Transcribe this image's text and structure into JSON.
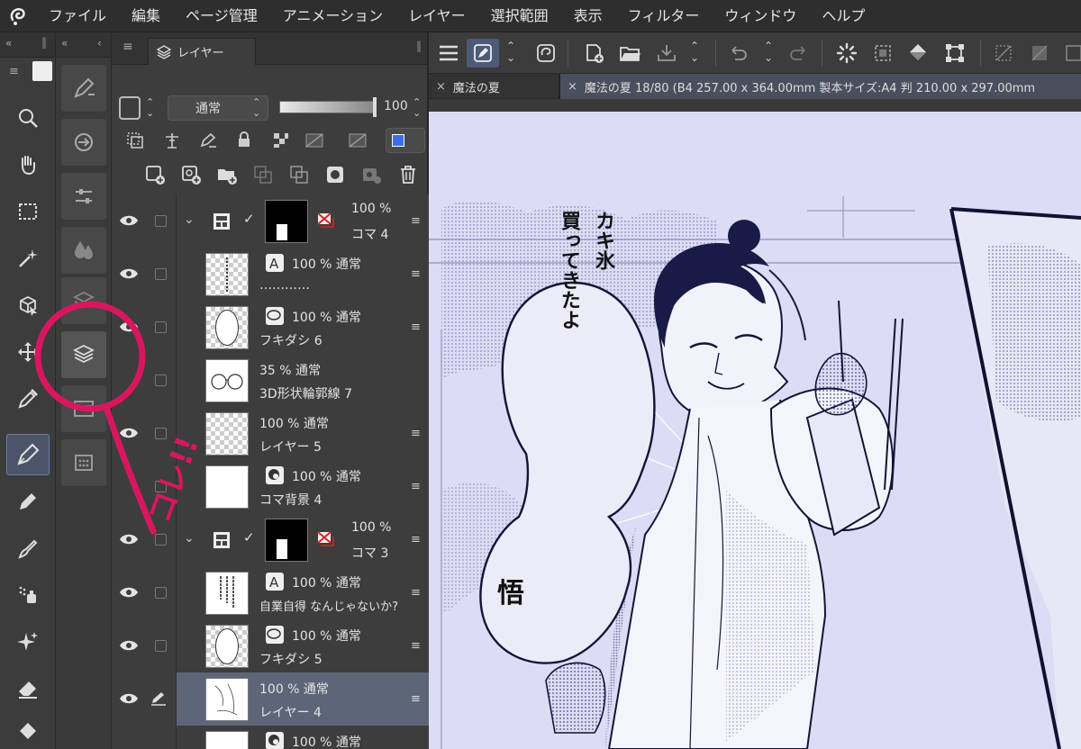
{
  "app": {
    "logo_icon": "clip-studio-logo-icon",
    "menu": [
      "ファイル",
      "編集",
      "ページ管理",
      "アニメーション",
      "レイヤー",
      "選択範囲",
      "表示",
      "フィルター",
      "ウィンドウ",
      "ヘルプ"
    ]
  },
  "tool_panel": {
    "tools": [
      "zoom-icon",
      "hand-icon",
      "rect-select-icon",
      "magic-wand-icon",
      "object-select-icon",
      "move-icon",
      "eyedropper-icon",
      "pen-icon",
      "pencil-icon",
      "brush-icon",
      "airbrush-icon",
      "decoration-icon",
      "eraser-icon",
      "fill-icon"
    ],
    "active_tool": "pen-icon"
  },
  "sub_panel": {
    "items": [
      "sub-tool-icon",
      "navigator-icon",
      "tool-property-icon",
      "color-icon",
      "layer-property-icon",
      "layer-icon",
      "timeline-icon",
      "material-icon"
    ],
    "active": "layer-icon"
  },
  "layer_panel": {
    "tab_label": "レイヤー",
    "blend_mode": "通常",
    "opacity": "100",
    "layers": [
      {
        "kind": "folder",
        "opacity": "100 %",
        "name": "コマ 4"
      },
      {
        "kind": "text",
        "mode": "100 % 通常",
        "name": "…………"
      },
      {
        "kind": "balloon",
        "mode": "100 % 通常",
        "name": "フキダシ 6"
      },
      {
        "kind": "3d",
        "mode": "35 % 通常",
        "name": "3D形状輪郭線 7"
      },
      {
        "kind": "raster",
        "mode": "100 % 通常",
        "name": "レイヤー 5"
      },
      {
        "kind": "paper",
        "mode": "100 % 通常",
        "name": "コマ背景 4"
      },
      {
        "kind": "folder",
        "opacity": "100 %",
        "name": "コマ 3"
      },
      {
        "kind": "text",
        "mode": "100 % 通常",
        "name": "自業自得 なんじゃないか?"
      },
      {
        "kind": "balloon",
        "mode": "100 % 通常",
        "name": "フキダシ 5"
      },
      {
        "kind": "raster",
        "mode": "100 % 通常",
        "name": "レイヤー 4"
      },
      {
        "kind": "paper",
        "mode": "100 % 通常",
        "name": ""
      }
    ],
    "selected_index": 9
  },
  "canvas_area": {
    "tabs": [
      "魔法の夏",
      "魔法の夏 18/80 (B4 257.00 x 364.00mm 製本サイズ:A4 判 210.00 x 297.00mm"
    ],
    "speech_text": [
      "カキ氷",
      "買ってきたよ"
    ],
    "speaker_text": "悟"
  },
  "annotation": {
    "label": "コレ!!"
  }
}
